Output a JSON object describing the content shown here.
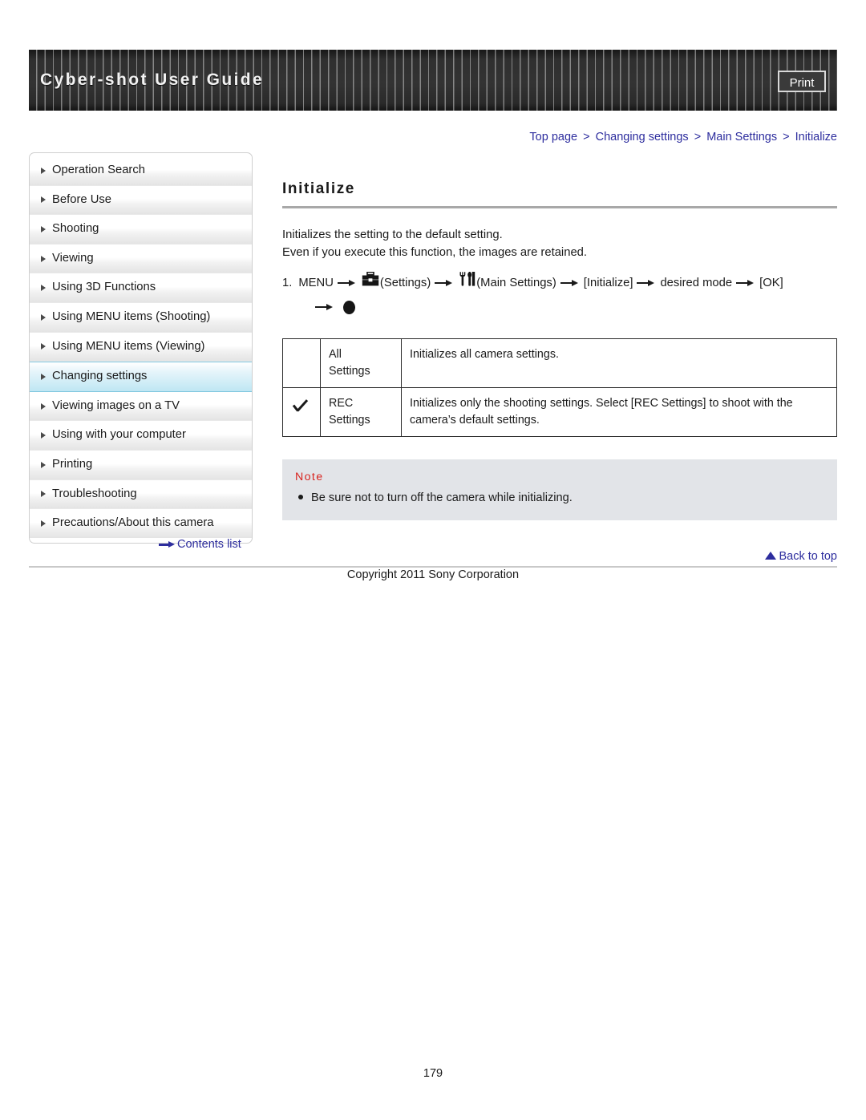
{
  "header": {
    "title": "Cyber-shot User Guide",
    "print_label": "Print"
  },
  "breadcrumb": {
    "items": [
      "Top page",
      "Changing settings",
      "Main Settings",
      "Initialize"
    ],
    "separator": ">"
  },
  "sidebar": {
    "items": [
      {
        "label": "Operation Search",
        "active": false
      },
      {
        "label": "Before Use",
        "active": false
      },
      {
        "label": "Shooting",
        "active": false
      },
      {
        "label": "Viewing",
        "active": false
      },
      {
        "label": "Using 3D Functions",
        "active": false
      },
      {
        "label": "Using MENU items (Shooting)",
        "active": false
      },
      {
        "label": "Using MENU items (Viewing)",
        "active": false
      },
      {
        "label": "Changing settings",
        "active": true
      },
      {
        "label": "Viewing images on a TV",
        "active": false
      },
      {
        "label": "Using with your computer",
        "active": false
      },
      {
        "label": "Printing",
        "active": false
      },
      {
        "label": "Troubleshooting",
        "active": false
      },
      {
        "label": "Precautions/About this camera",
        "active": false
      }
    ],
    "contents_list_label": "Contents list"
  },
  "main": {
    "title": "Initialize",
    "intro_line1": "Initializes the setting to the default setting.",
    "intro_line2": "Even if you execute this function, the images are retained.",
    "step": {
      "number": "1.",
      "menu_label": "MENU",
      "settings_label": "(Settings)",
      "main_settings_label": "(Main Settings)",
      "initialize_label": "[Initialize]",
      "desired_mode_label": "desired mode",
      "ok_label": "[OK]"
    },
    "table": {
      "rows": [
        {
          "checked": false,
          "label": "All\nSettings",
          "label_line1": "All",
          "label_line2": "Settings",
          "description": "Initializes all camera settings."
        },
        {
          "checked": true,
          "label": "REC\nSettings",
          "label_line1": "REC",
          "label_line2": "Settings",
          "description": "Initializes only the shooting settings. Select [REC Settings] to shoot with the camera’s default settings."
        }
      ]
    },
    "note": {
      "heading": "Note",
      "items": [
        "Be sure not to turn off the camera while initializing."
      ]
    }
  },
  "footer": {
    "back_to_top_label": "Back to top",
    "copyright": "Copyright 2011 Sony Corporation",
    "page_number": "179"
  }
}
